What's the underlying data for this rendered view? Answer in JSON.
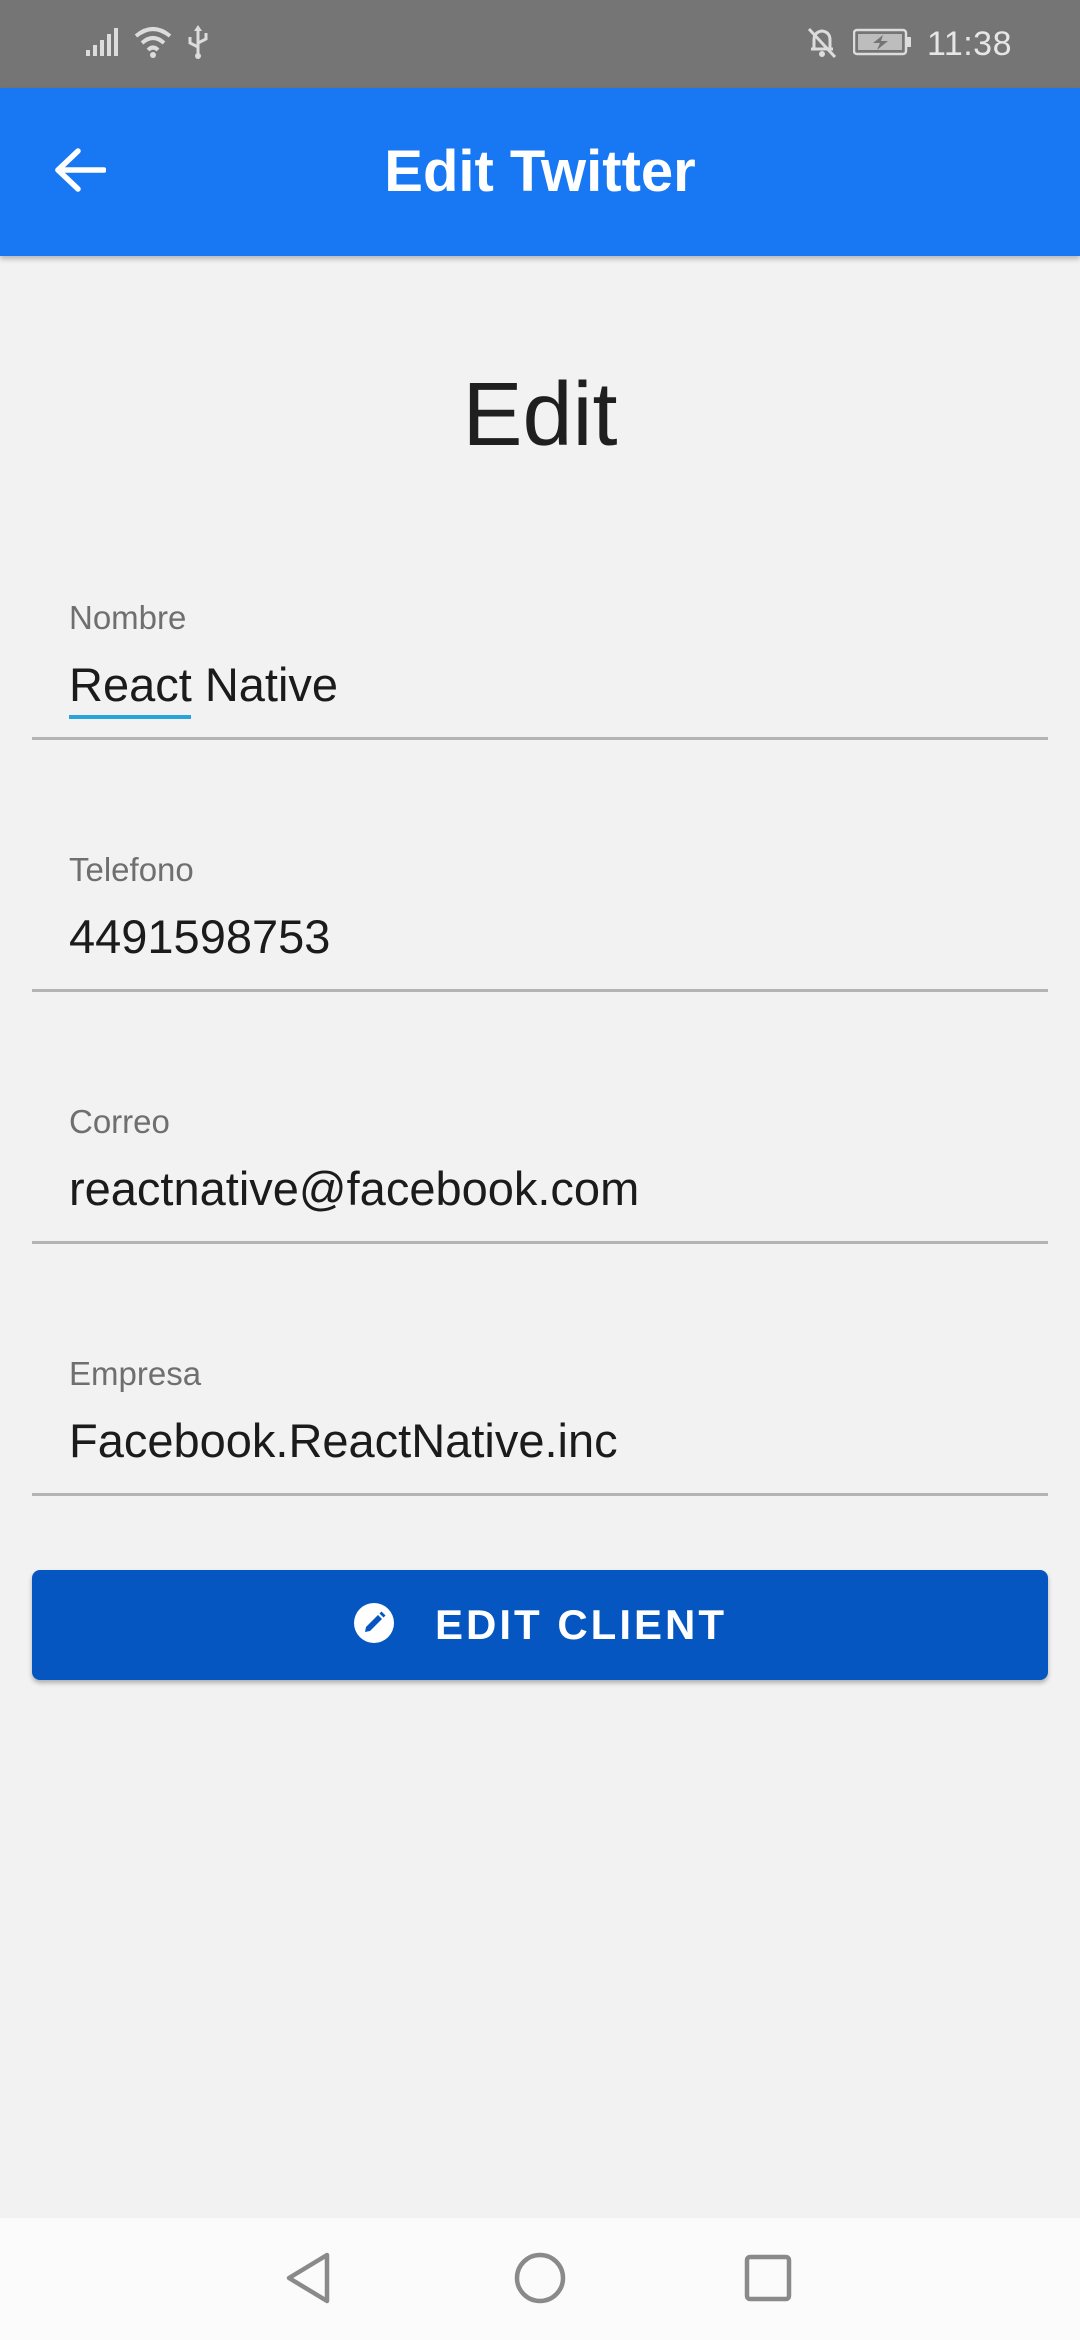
{
  "status_bar": {
    "time": "11:38",
    "icons": [
      "signal-icon",
      "wifi-icon",
      "usb-icon",
      "notifications-off-icon",
      "battery-charging-icon"
    ]
  },
  "app_bar": {
    "title": "Edit Twitter",
    "back_icon": "arrow-back-icon",
    "background_color": "#1877f2"
  },
  "page": {
    "heading": "Edit"
  },
  "form": {
    "fields": [
      {
        "label": "Nombre",
        "value": "React Native"
      },
      {
        "label": "Telefono",
        "value": "4491598753"
      },
      {
        "label": "Correo",
        "value": "reactnative@facebook.com"
      },
      {
        "label": "Empresa",
        "value": "Facebook.ReactNative.inc"
      }
    ]
  },
  "button": {
    "label": "EDIT CLIENT",
    "icon": "pencil-icon",
    "color": "#0556c0"
  },
  "nav_bar": {
    "buttons": [
      "back-triangle-icon",
      "home-circle-icon",
      "recents-square-icon"
    ]
  }
}
